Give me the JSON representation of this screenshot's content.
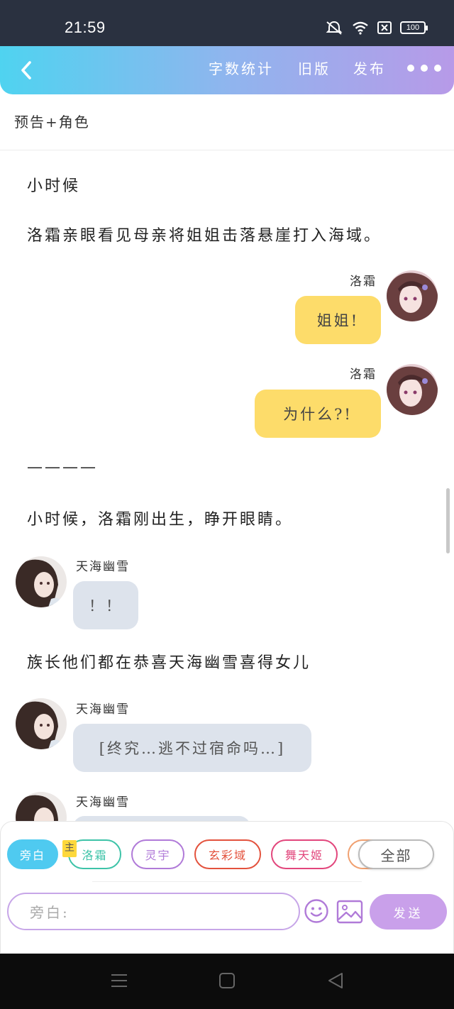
{
  "status_bar": {
    "time": "21:59",
    "battery": "100"
  },
  "nav": {
    "stats_label": "字数统计",
    "old_version_label": "旧版",
    "publish_label": "发布"
  },
  "subtitle": "预告+角色",
  "content": {
    "narration_1": "小时候",
    "narration_2": "洛霜亲眼看见母亲将姐姐击落悬崖打入海域。",
    "msg_1": {
      "name": "洛霜",
      "text": "姐姐!"
    },
    "msg_2": {
      "name": "洛霜",
      "text": "为什么?!"
    },
    "separator": "————",
    "narration_3": "小时候，洛霜刚出生，睁开眼睛。",
    "msg_3": {
      "name": "天海幽雪",
      "text": "！！"
    },
    "narration_4": "族长他们都在恭喜天海幽雪喜得女儿",
    "msg_4": {
      "name": "天海幽雪",
      "text": "[终究…逃不过宿命吗…]"
    },
    "msg_5": {
      "name": "天海幽雪"
    }
  },
  "roles": {
    "narrator": "旁白",
    "main_tag": "主",
    "luoshuang": "洛霜",
    "lingyu": "灵宇",
    "xuancai": "玄彩域",
    "wutian": "舞天姬",
    "all": "全部"
  },
  "input": {
    "placeholder": "旁白:"
  },
  "send_label": "发送",
  "colors": {
    "gradient_start": "#4fd3f0",
    "gradient_end": "#b79ae8",
    "bubble_right": "#fddc6a",
    "bubble_left": "#dde3ec",
    "send": "#c9a0ea"
  }
}
